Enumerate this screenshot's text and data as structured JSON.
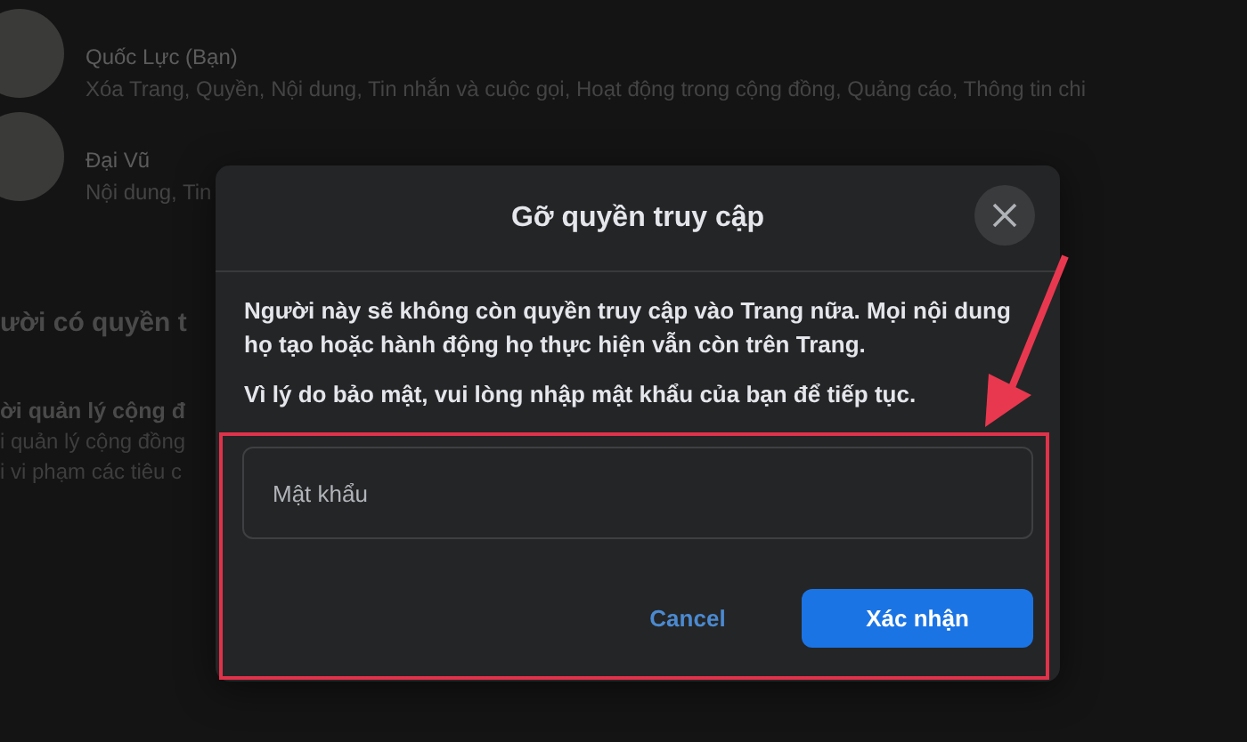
{
  "background": {
    "people": [
      {
        "name": "Quốc Lực (Bạn)",
        "permissions": "Xóa Trang, Quyền, Nội dung, Tin nhắn và cuộc gọi, Hoạt động trong cộng đồng, Quảng cáo, Thông tin chi"
      },
      {
        "name": "Đại Vũ",
        "permissions": "Nội dung, Tin"
      }
    ],
    "section_heading": "ười có quyền t",
    "role": {
      "title": "ời quản lý cộng đ",
      "lines": [
        "i quản lý cộng đồng",
        "i vi phạm các tiêu c"
      ]
    }
  },
  "dialog": {
    "title": "Gỡ quyền truy cập",
    "paragraphs": [
      "Người này sẽ không còn quyền truy cập vào Trang nữa. Mọi nội dung họ tạo hoặc hành động họ thực hiện vẫn còn trên Trang.",
      "Vì lý do bảo mật, vui lòng nhập mật khẩu của bạn để tiếp tục."
    ],
    "password": {
      "placeholder": "Mật khẩu"
    },
    "buttons": [
      {
        "label": "Cancel",
        "kind": "secondary"
      },
      {
        "label": "Xác nhận",
        "kind": "primary"
      }
    ]
  }
}
